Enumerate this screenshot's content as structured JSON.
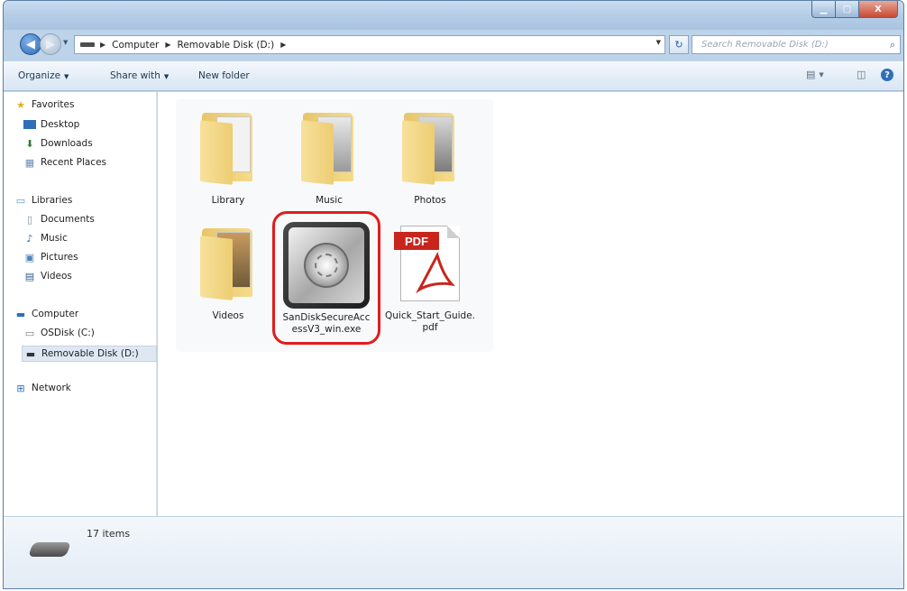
{
  "window": {
    "caption_buttons": {
      "minimize_icon": "minimize-icon",
      "maximize_icon": "maximize-icon",
      "close_label": "X"
    }
  },
  "address_bar": {
    "crumbs": [
      "Computer",
      "Removable Disk (D:)"
    ],
    "search_placeholder": "Search Removable Disk (D:)"
  },
  "toolbar": {
    "organize": "Organize",
    "share_with": "Share with",
    "new_folder": "New folder"
  },
  "nav": {
    "favorites": "Favorites",
    "desktop": "Desktop",
    "downloads": "Downloads",
    "recent_places": "Recent Places",
    "libraries": "Libraries",
    "documents": "Documents",
    "music": "Music",
    "pictures": "Pictures",
    "videos": "Videos",
    "computer": "Computer",
    "osdisk": "OSDisk (C:)",
    "removable": "Removable Disk (D:)",
    "network": "Network"
  },
  "files": [
    {
      "name": "Library",
      "icon": "folder-icon"
    },
    {
      "name": "Music",
      "icon": "folder-icon"
    },
    {
      "name": "Photos",
      "icon": "folder-icon"
    },
    {
      "name": "Videos",
      "icon": "folder-icon"
    },
    {
      "name": "SanDiskSecureAccessV3_win.exe",
      "icon": "safe-icon",
      "highlighted": true
    },
    {
      "name": "Quick_Start_Guide.pdf",
      "icon": "pdf-icon",
      "badge": "PDF"
    }
  ],
  "status": {
    "item_count": "17 items"
  },
  "colors": {
    "highlight": "#e21c1c",
    "chrome": "#bcd3ea",
    "selection": "#dbe9f7"
  }
}
